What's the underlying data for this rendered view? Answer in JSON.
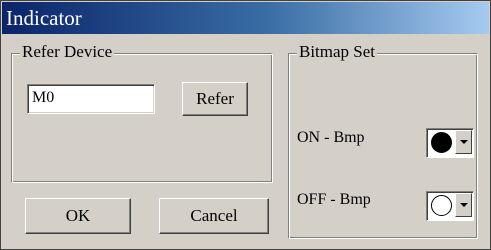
{
  "window": {
    "title": "Indicator"
  },
  "refer_device": {
    "group_label": "Refer Device",
    "device_value": "M0",
    "refer_button_label": "Refer"
  },
  "bitmap_set": {
    "group_label": "Bitmap Set",
    "on_label": "ON - Bmp",
    "off_label": "OFF - Bmp",
    "on_icon": "filled-circle-icon",
    "off_icon": "empty-circle-icon"
  },
  "buttons": {
    "ok_label": "OK",
    "cancel_label": "Cancel"
  },
  "colors": {
    "titlebar_start": "#0a246a",
    "titlebar_end": "#a6caf0",
    "dialog_face": "#d4d0c8"
  }
}
